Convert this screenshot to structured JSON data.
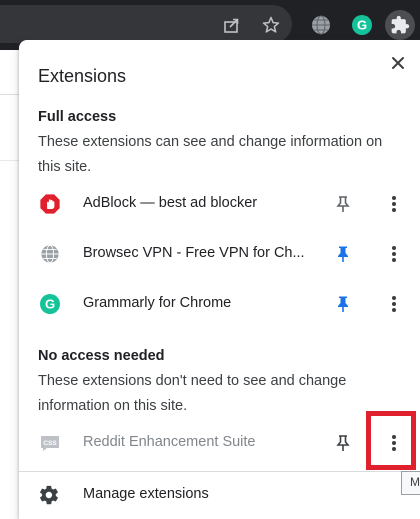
{
  "popup": {
    "title": "Extensions",
    "close_icon": "close-icon"
  },
  "full_access": {
    "title": "Full access",
    "description": "These extensions can see and change information on this site.",
    "items": [
      {
        "name": "AdBlock — best ad blocker",
        "icon": "adblock-icon",
        "pinned": false
      },
      {
        "name": "Browsec VPN - Free VPN for Ch...",
        "icon": "globe-icon",
        "pinned": true
      },
      {
        "name": "Grammarly for Chrome",
        "icon": "grammarly-icon",
        "pinned": true
      }
    ]
  },
  "no_access": {
    "title": "No access needed",
    "description": "These extensions don't need to see and change information on this site.",
    "items": [
      {
        "name": "Reddit Enhancement Suite",
        "icon": "css-icon",
        "pinned": false
      }
    ]
  },
  "footer": {
    "manage_label": "Manage extensions"
  },
  "tooltip": {
    "text": "M"
  },
  "colors": {
    "pin_active": "#1a73e8",
    "pin_inactive": "#5f6368",
    "highlight": "#e0202c",
    "adblock_red": "#e0202c",
    "grammarly_green": "#15c39a"
  }
}
